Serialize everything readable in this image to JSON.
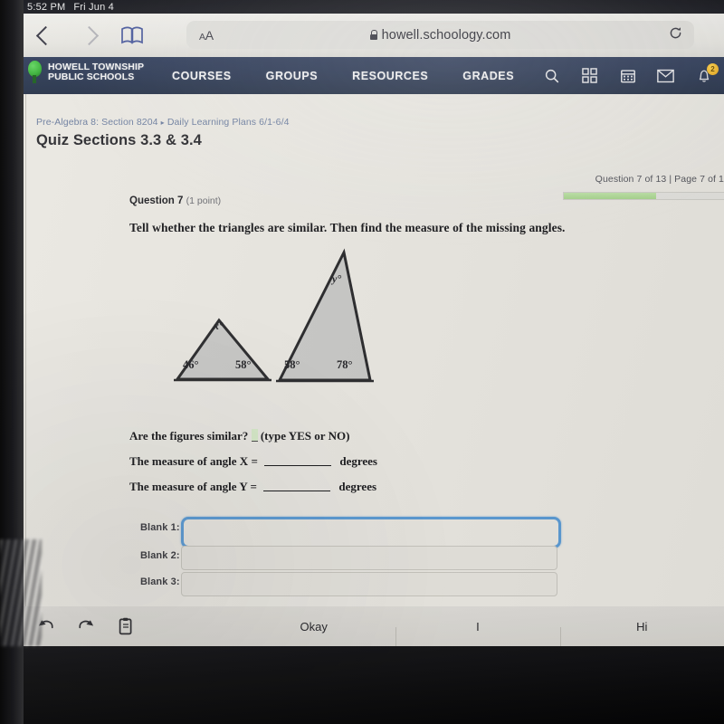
{
  "status_bar": {
    "time": "5:52 PM",
    "date": "Fri Jun 4"
  },
  "browser": {
    "back_icon": "chevron-left-icon",
    "forward_icon": "chevron-right-icon",
    "bookmarks_icon": "book-icon",
    "text_size_label": "AA",
    "url": "howell.schoology.com",
    "lock_icon": "lock-icon",
    "reload_icon": "reload-icon"
  },
  "site_nav": {
    "logo_line1": "HOWELL TOWNSHIP",
    "logo_line2": "PUBLIC SCHOOLS",
    "logo_icon": "tree-logo-icon",
    "links": [
      {
        "label": "COURSES"
      },
      {
        "label": "GROUPS"
      },
      {
        "label": "RESOURCES"
      },
      {
        "label": "GRADES"
      }
    ],
    "icons": [
      {
        "name": "search-icon"
      },
      {
        "name": "grid-apps-icon"
      },
      {
        "name": "calendar-icon"
      },
      {
        "name": "mail-icon"
      },
      {
        "name": "bell-notifications-icon"
      }
    ],
    "notification_count": "2"
  },
  "breadcrumb": {
    "course": "Pre-Algebra 8: Section 8204",
    "separator": "▸",
    "folder": "Daily Learning Plans 6/1-6/4"
  },
  "quiz": {
    "title": "Quiz Sections 3.3 & 3.4",
    "progress_text": "Question 7 of 13 | Page 7 of 1",
    "progress_percent": 56,
    "question_label": "Question 7",
    "question_points": "(1 point)",
    "prompt": "Tell whether the triangles are similar.  Then find the measure of the missing angles."
  },
  "figure": {
    "type": "two-triangles",
    "small_triangle": {
      "bottom_left_angle": "46°",
      "bottom_right_angle": "58°",
      "apex_angle": "x°"
    },
    "large_triangle": {
      "bottom_left_angle": "58°",
      "bottom_right_angle": "78°",
      "apex_angle": "y°"
    }
  },
  "answers": {
    "line1_text": "Are the figures similar?",
    "line1_hint": "(type YES or NO)",
    "line2_prefix": "The measure of angle X =",
    "line2_suffix": "degrees",
    "line3_prefix": "The measure of angle Y =",
    "line3_suffix": "degrees"
  },
  "blanks": [
    {
      "label": "Blank 1:",
      "value": "",
      "focused": true
    },
    {
      "label": "Blank 2:",
      "value": "",
      "focused": false
    },
    {
      "label": "Blank 3:",
      "value": "",
      "focused": false
    }
  ],
  "keyboard_bar": {
    "icons": [
      {
        "name": "undo-icon"
      },
      {
        "name": "redo-icon"
      },
      {
        "name": "paste-icon"
      }
    ],
    "suggestions": [
      {
        "label": "Okay"
      },
      {
        "label": "I"
      },
      {
        "label": "Hi"
      }
    ]
  },
  "colors": {
    "nav_blue": "#2d3a55",
    "breadcrumb_blue": "#6e7fa0",
    "progress_green": "#a8d68e",
    "focus_blue": "#5b9bd5",
    "page_bg": "#eae8e2"
  }
}
